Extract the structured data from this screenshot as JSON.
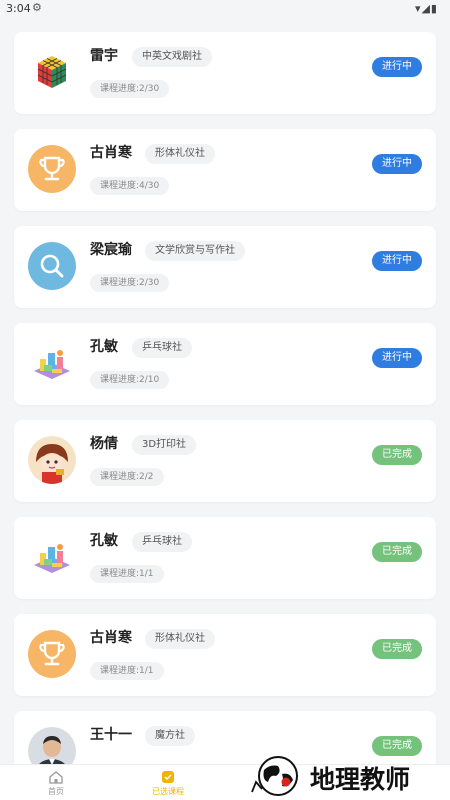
{
  "status_bar": {
    "time": "3:04"
  },
  "cards": [
    {
      "name": "雷宇",
      "club": "中英文戏剧社",
      "progress": "课程进度:2/30",
      "status": "进行中"
    },
    {
      "name": "古肖寒",
      "club": "形体礼仪社",
      "progress": "课程进度:4/30",
      "status": "进行中"
    },
    {
      "name": "梁宸瑜",
      "club": "文学欣赏与写作社",
      "progress": "课程进度:2/30",
      "status": "进行中"
    },
    {
      "name": "孔敏",
      "club": "乒乓球社",
      "progress": "课程进度:2/10",
      "status": "进行中"
    },
    {
      "name": "杨倩",
      "club": "3D打印社",
      "progress": "课程进度:2/2",
      "status": "已完成"
    },
    {
      "name": "孔敏",
      "club": "乒乓球社",
      "progress": "课程进度:1/1",
      "status": "已完成"
    },
    {
      "name": "古肖寒",
      "club": "形体礼仪社",
      "progress": "课程进度:1/1",
      "status": "已完成"
    },
    {
      "name": "王十一",
      "club": "魔方社",
      "progress": "",
      "status": "已完成"
    }
  ],
  "avatars": [
    "rubik-cube-icon",
    "trophy-icon",
    "search-icon",
    "building-blocks-icon",
    "cartoon-girl-avatar",
    "building-blocks-icon",
    "trophy-icon",
    "man-photo-avatar"
  ],
  "bottom_nav": {
    "home": "首页",
    "my_courses": "已选课程"
  },
  "colors": {
    "ongoing": "#2f7de1",
    "done": "#74c27c",
    "accent": "#f0b400"
  },
  "watermark": {
    "text": "地理教师"
  }
}
